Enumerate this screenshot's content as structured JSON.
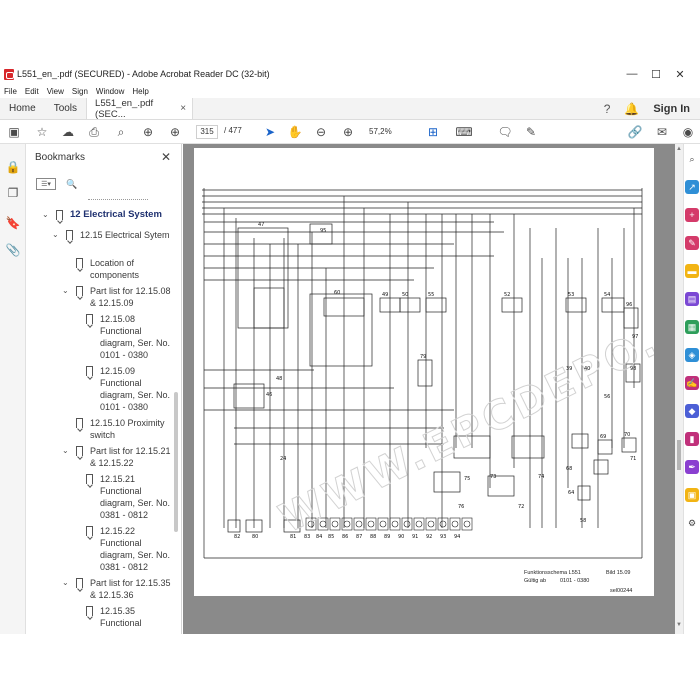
{
  "window": {
    "title": "L551_en_.pdf (SECURED) - Adobe Acrobat Reader DC (32-bit)",
    "controls": [
      "—",
      "☐",
      "✕"
    ]
  },
  "menu": [
    "File",
    "Edit",
    "View",
    "Sign",
    "Window",
    "Help"
  ],
  "tabs": {
    "home": "Home",
    "tools": "Tools",
    "document": "L551_en_.pdf (SEC...",
    "close": "×",
    "sign_in": "Sign In"
  },
  "toolbar": {
    "current_page": "315",
    "total_pages": "/ 477",
    "zoom": "57,2%"
  },
  "bookmarks": {
    "header": "Bookmarks",
    "close": "✕",
    "items": [
      {
        "label": "12  Electrical System"
      },
      {
        "label": "12.15  Electrical Sytem"
      },
      {
        "label": "Location of components"
      },
      {
        "label": "Part list for 12.15.08 & 12.15.09"
      },
      {
        "label": "12.15.08 Functional diagram, Ser. No. 0101 - 0380"
      },
      {
        "label": "12.15.09 Functional diagram, Ser. No. 0101 - 0380"
      },
      {
        "label": "12.15.10 Proximity switch"
      },
      {
        "label": "Part list for 12.15.21 & 12.15.22"
      },
      {
        "label": "12.15.21 Functional diagram, Ser. No. 0381 - 0812"
      },
      {
        "label": "12.15.22 Functional diagram, Ser. No. 0381 - 0812"
      },
      {
        "label": "Part list for 12.15.35 & 12.15.36"
      },
      {
        "label": "12.15.35 Functional"
      }
    ]
  },
  "diagram": {
    "title_line1": "Funktionsschema L551",
    "title_bild": "Bild 15.09",
    "title_line2": "Gültig ab",
    "title_range": "0101 - 0380",
    "ref": "sel00244",
    "watermark": "WWW.EPCDEPO.COM",
    "component_numbers": [
      "47",
      "95",
      "60",
      "49",
      "50",
      "55",
      "52",
      "53",
      "54",
      "96",
      "97",
      "98",
      "69",
      "70",
      "71",
      "68",
      "64",
      "72",
      "73",
      "74",
      "75",
      "76",
      "79",
      "46",
      "48",
      "82",
      "80",
      "81",
      "83",
      "84",
      "85",
      "86",
      "87",
      "88",
      "89",
      "90",
      "91",
      "92",
      "93",
      "94",
      "24",
      "39",
      "40",
      "56",
      "58"
    ]
  },
  "colors": {
    "accent": "#1f3170",
    "viewer_bg": "#8a8a8a",
    "watermark": "#d6d6d6"
  }
}
